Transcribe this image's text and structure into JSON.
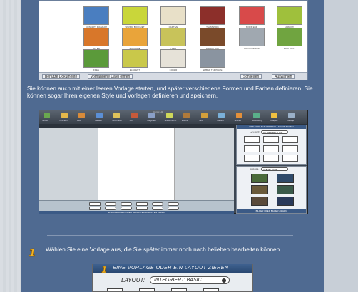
{
  "gallery": {
    "captions": [
      "CONCEPT DIAGRAM",
      "SPRING BOUQUET",
      "CAPTIVE",
      "TEAMWORK",
      "BOOK END",
      "ARROW",
      "AFTER",
      "SUNSHINE",
      "TREE",
      "DIRECT OUT",
      "PHOTO ALBUM",
      "BABY TEXT",
      "FREE",
      "ELEMENT",
      "COVER",
      "EMBED TEMPLATE"
    ],
    "colors": [
      "#4a7ec0",
      "#c9d63a",
      "#e8e0c8",
      "#8c2f2a",
      "#d84a4a",
      "#9fc03c",
      "#d8772a",
      "#e9a43a",
      "#c8c35a",
      "#7a4a2a",
      "#a0a8b0",
      "#70a440",
      "#5b9a3a",
      "#c9c84a",
      "#e6e2d8",
      "#8a94a0"
    ],
    "buttons": {
      "browse": "Benutze Dokumente",
      "existing": "Vorhandene Datei öffnen",
      "close": "Schließen",
      "select": "Auswählen"
    }
  },
  "intro_text": "Sie können auch mit einer leeren Vorlage starten, und später verschiedene Formen und Farben definieren. Sie können sogar Ihren eigenen Style und Vorlagen definieren und speichern.",
  "editor": {
    "window_title": "Comic Life",
    "toolbar": [
      "Neues",
      "Drucken",
      "Bild",
      "Tastatur",
      "Text/Label",
      "Stil",
      "Vorgehen",
      "Wiederherst.",
      "Ebene",
      "Bild",
      "Vollbild",
      "Shared",
      "Gestaltung",
      "Vorlagen",
      "Vorlage"
    ],
    "panel_top_title": "EINE VORLAGE ODER EIN LAYOUT ZIEHEN",
    "layout_label": "LAYOUT:",
    "layout_value": "INTEGRIERT: TYPE",
    "panel_bottom_title": "ALBUM:",
    "album_value": "ALBUM: TYPE",
    "bottom_caption": "SPRECHBLASEN ODER BILDUNTERSCHRIFTEN ZIEHEN",
    "right_caption": "BILDER ODER BILDER ZIEHEN"
  },
  "step": {
    "number": "1",
    "text": "Wählen Sie eine Vorlage aus, die Sie später immer noch nach belieben bearbeiten können."
  },
  "panel3": {
    "number": "1",
    "title": "EINE VORLAGE ODER EIN LAYOUT ZIEHEN",
    "layout_label": "LAYOUT:",
    "layout_value": "INTEGRIERT: BASIC"
  }
}
